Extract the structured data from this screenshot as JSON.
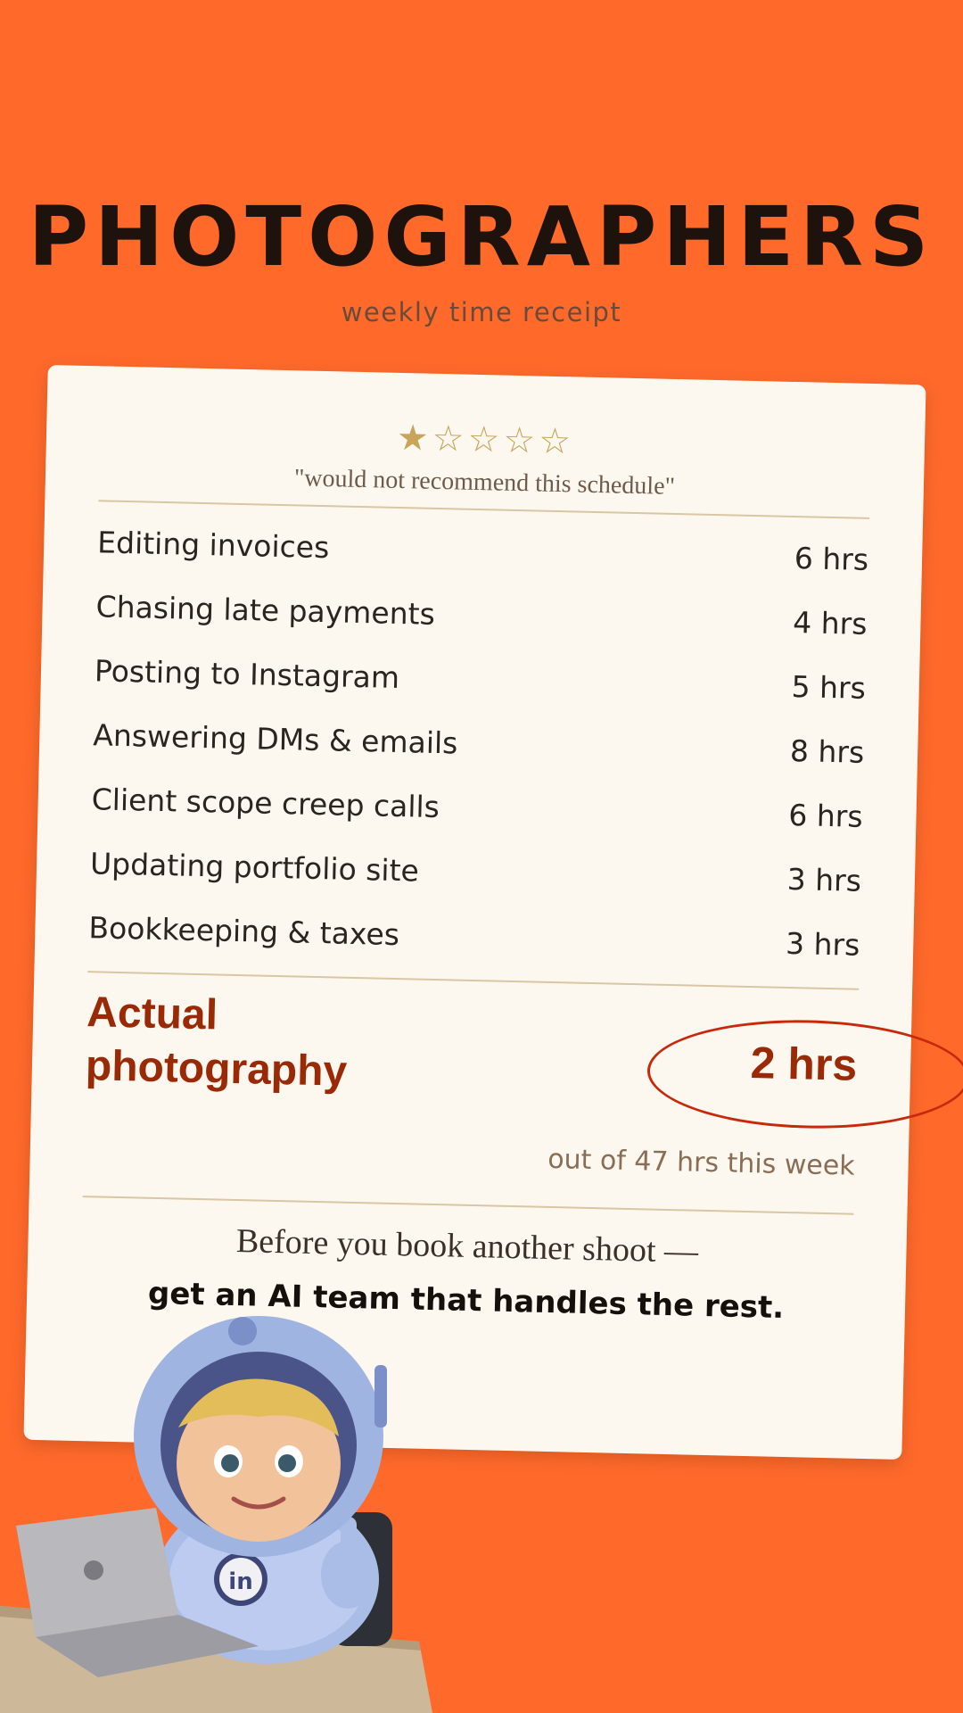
{
  "header": {
    "title": "PHOTOGRAPHERS",
    "subtitle": "weekly time receipt"
  },
  "receipt": {
    "rating": {
      "stars_filled": 1,
      "stars_total": 5
    },
    "quote": "\"would not recommend this schedule\"",
    "items": [
      {
        "label": "Editing invoices",
        "hours": "6 hrs"
      },
      {
        "label": "Chasing late payments",
        "hours": "4 hrs"
      },
      {
        "label": "Posting to Instagram",
        "hours": "5 hrs"
      },
      {
        "label": "Answering DMs & emails",
        "hours": "8 hrs"
      },
      {
        "label": "Client scope creep calls",
        "hours": "6 hrs"
      },
      {
        "label": "Updating portfolio site",
        "hours": "3 hrs"
      },
      {
        "label": "Bookkeeping & taxes",
        "hours": "3 hrs"
      }
    ],
    "total": {
      "label_line1": "Actual",
      "label_line2": "photography",
      "hours": "2 hrs"
    },
    "summary": "out of 47 hrs this week",
    "cta_line1": "Before you book another shoot —",
    "cta_line2": "get an AI team that handles the rest."
  },
  "colors": {
    "background": "#ff6a2b",
    "card": "#fdf8ef",
    "accent": "#9a2a06",
    "star": "#c9a55c"
  },
  "mascot": {
    "badge": "in",
    "icons": [
      "astronaut-mascot",
      "laptop-icon",
      "apple-logo-icon"
    ]
  }
}
